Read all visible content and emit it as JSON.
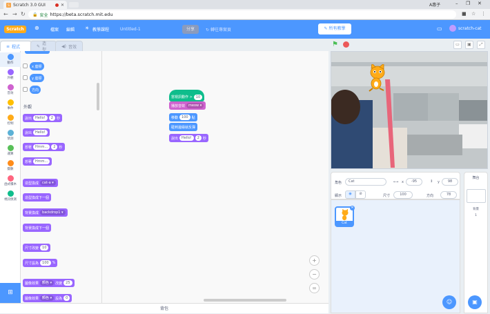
{
  "browser": {
    "tab_title": "Scratch 3.0 GUI",
    "user": "A惠子",
    "secure_label": "安全",
    "url": "https://beta.scratch.mit.edu"
  },
  "menubar": {
    "logo": "Scratch",
    "file": "檔案",
    "edit": "編輯",
    "tutorials_tip": "教學課程",
    "project_title": "Untitled-1",
    "share": "分享",
    "see_project": "轉往專案頁",
    "tutorials_button": "所有教學",
    "account": "scratch-cat"
  },
  "tabs": {
    "code": "程式",
    "costumes": "造型",
    "sounds": "音效"
  },
  "categories": [
    {
      "label": "動作",
      "color": "#4c97ff"
    },
    {
      "label": "外觀",
      "color": "#9966ff"
    },
    {
      "label": "音效",
      "color": "#cf63cf"
    },
    {
      "label": "事件",
      "color": "#ffbf00"
    },
    {
      "label": "控制",
      "color": "#ffab19"
    },
    {
      "label": "偵測",
      "color": "#5cb1d6"
    },
    {
      "label": "運算",
      "color": "#59c059"
    },
    {
      "label": "變數",
      "color": "#ff8c1a"
    },
    {
      "label": "函式積木",
      "color": "#ff6680"
    },
    {
      "label": "視訊偵測",
      "color": "#0fbd8c"
    }
  ],
  "palette": {
    "motion_reporters": [
      "x 座標",
      "y 座標",
      "方向"
    ],
    "looks_header": "外觀",
    "say_timed": {
      "label": "說出",
      "text": "Hello!",
      "secs": "2",
      "unit": "秒"
    },
    "say": {
      "label": "說出",
      "text": "Hello!"
    },
    "think_timed": {
      "label": "想著",
      "text": "Hmm...",
      "secs": "2",
      "unit": "秒"
    },
    "think": {
      "label": "想著",
      "text": "Hmm..."
    },
    "switch_costume": {
      "label": "造型換成",
      "value": "cat-a"
    },
    "next_costume": "造型換成下一個",
    "switch_backdrop": {
      "label": "背景換成",
      "value": "backdrop1"
    },
    "next_backdrop": "背景換成下一個",
    "change_size": {
      "label": "尺寸改變",
      "value": "10"
    },
    "set_size": {
      "label": "尺寸設為",
      "value": "100",
      "unit": "%"
    },
    "change_effect": {
      "label": "圖像效果",
      "effect": "顏色",
      "mid": "改變",
      "value": "25"
    },
    "set_effect": {
      "label": "圖像效果",
      "effect": "顏色",
      "mid": "設為",
      "value": "0"
    }
  },
  "script": {
    "hat": {
      "label": "當視訊動作 >",
      "value": "10"
    },
    "sound": {
      "label": "播放音效",
      "value": "meow"
    },
    "move": {
      "label": "移動",
      "value": "100",
      "unit": "點"
    },
    "bounce": "碰到邊緣就反彈",
    "say": {
      "label": "說出",
      "text": "Hello!",
      "secs": "2",
      "unit": "秒"
    }
  },
  "workspace": {
    "backpack": "背包"
  },
  "sprite_info": {
    "sprite_label": "角色",
    "sprite_name": "Cat",
    "x_label": "x",
    "x_value": "-95",
    "y_label": "y",
    "y_value": "98",
    "show_label": "顯示",
    "size_label": "尺寸",
    "size_value": "100",
    "direction_label": "方向",
    "direction_value": "78"
  },
  "sprites": [
    {
      "name": "Cat"
    }
  ],
  "stage_pane": {
    "title": "舞台",
    "backdrops_label": "背景",
    "backdrops_count": "1"
  },
  "colors": {
    "accent": "#4c97ff",
    "looks": "#9966ff",
    "sound": "#cf63cf",
    "event": "#ffbf00"
  }
}
